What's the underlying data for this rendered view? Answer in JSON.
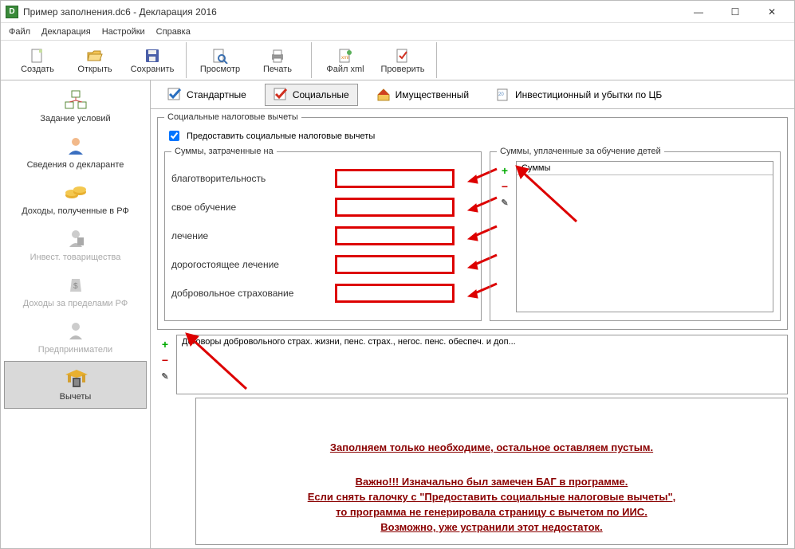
{
  "window": {
    "title": "Пример заполнения.dc6 - Декларация 2016"
  },
  "menu": {
    "file": "Файл",
    "declaration": "Декларация",
    "settings": "Настройки",
    "help": "Справка"
  },
  "toolbar": {
    "create": "Создать",
    "open": "Открыть",
    "save": "Сохранить",
    "preview": "Просмотр",
    "print": "Печать",
    "filexml": "Файл xml",
    "check": "Проверить"
  },
  "sidebar": {
    "conditions": "Задание условий",
    "declarant": "Сведения о декларанте",
    "income_rf": "Доходы, полученные в РФ",
    "invest": "Инвест. товарищества",
    "income_foreign": "Доходы за пределами РФ",
    "entrepreneurs": "Предприниматели",
    "deductions": "Вычеты"
  },
  "tabs": {
    "standard": "Стандартные",
    "social": "Социальные",
    "property": "Имущественный",
    "investment": "Инвестиционный и убытки по ЦБ"
  },
  "social": {
    "group_title": "Социальные налоговые вычеты",
    "provide_checkbox": "Предоставить социальные налоговые вычеты",
    "spent_title": "Суммы, затраченные на",
    "charity": "благотворительность",
    "own_education": "свое обучение",
    "treatment": "лечение",
    "expensive_treatment": "дорогостоящее лечение",
    "voluntary_insurance": "добровольное страхование",
    "children_title": "Суммы, уплаченные за обучение детей",
    "children_header": "Суммы",
    "contracts_header": "Договоры добровольного страх. жизни, пенс. страх., негос. пенс. обеспеч. и доп..."
  },
  "notes": {
    "line1": "Заполняем только необходиме, остальное оставляем пустым.",
    "line2": "Важно!!! Изначально был замечен БАГ в программе.",
    "line3": "Если снять галочку с \"Предоставить социальные налоговые вычеты\",",
    "line4": "то программа не генерировала страницу с вычетом по ИИС.",
    "line5": "Возможно, уже устранили этот недостаток."
  }
}
